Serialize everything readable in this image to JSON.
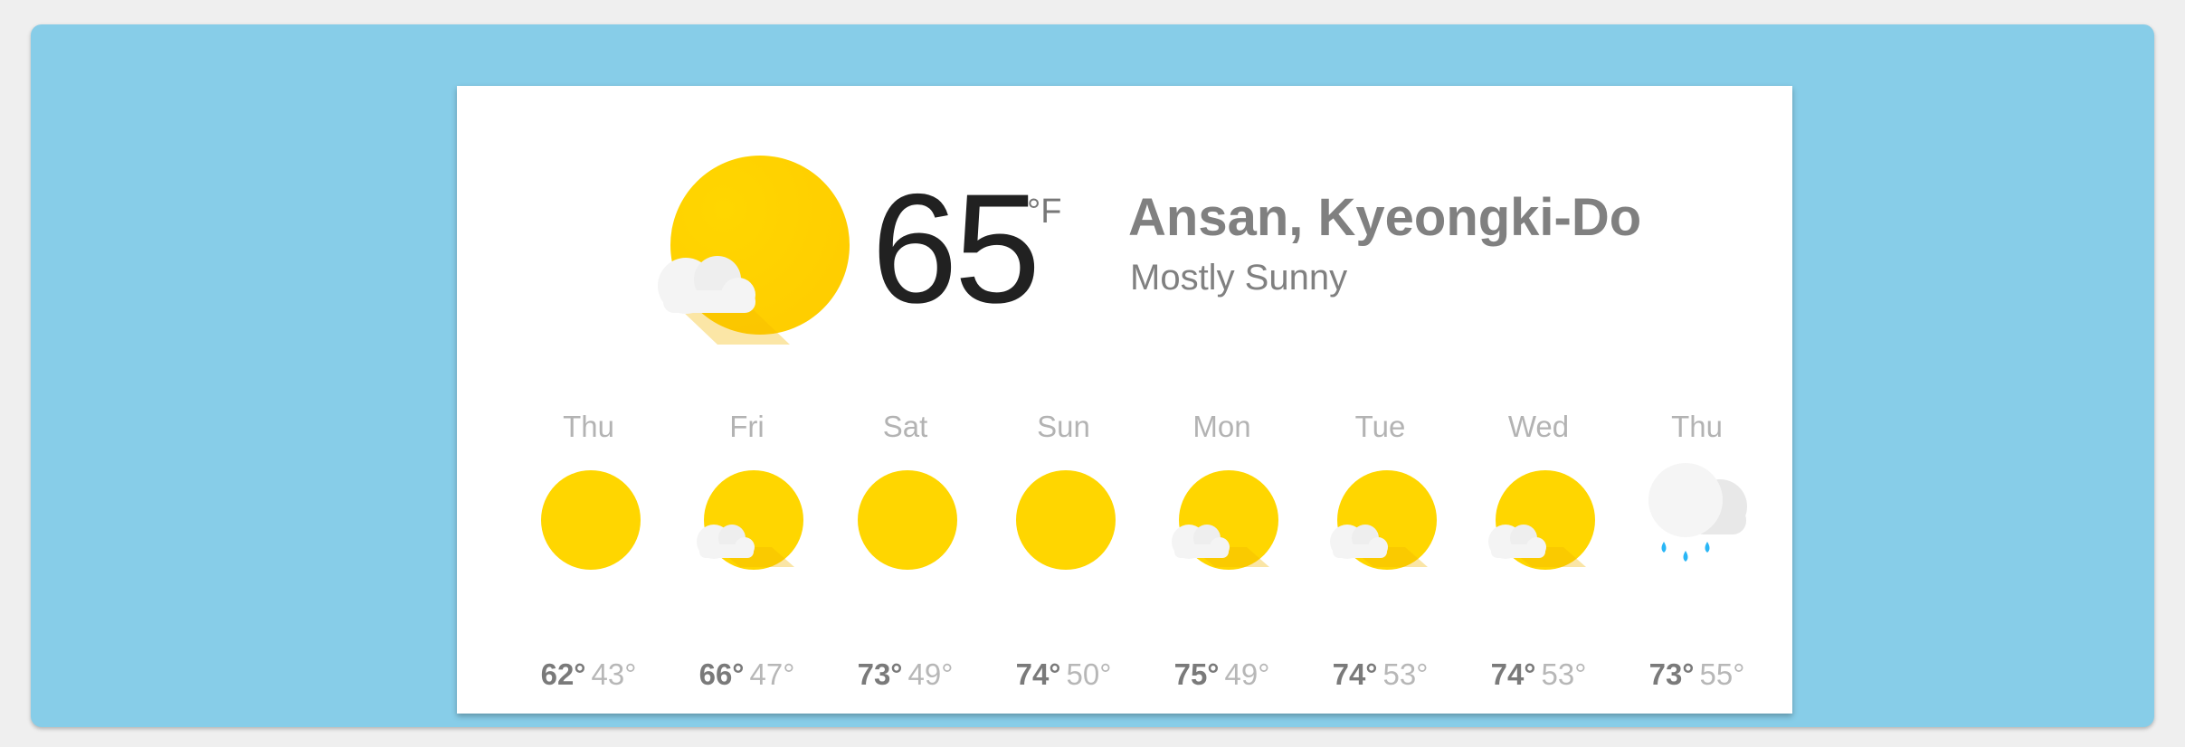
{
  "current": {
    "temperature": "65",
    "unit": "°F",
    "location": "Ansan, Kyeongki-Do",
    "condition": "Mostly Sunny",
    "icon": "mostly-sunny-icon"
  },
  "colors": {
    "background": "#87cde8",
    "sun": "#ffd600",
    "cloud": "#f2f2f2",
    "rain": "#29b6f6"
  },
  "forecast": [
    {
      "day": "Thu",
      "high": "62°",
      "low": "43°",
      "icon": "sunny-icon"
    },
    {
      "day": "Fri",
      "high": "66°",
      "low": "47°",
      "icon": "mostly-sunny-icon"
    },
    {
      "day": "Sat",
      "high": "73°",
      "low": "49°",
      "icon": "sunny-icon"
    },
    {
      "day": "Sun",
      "high": "74°",
      "low": "50°",
      "icon": "sunny-icon"
    },
    {
      "day": "Mon",
      "high": "75°",
      "low": "49°",
      "icon": "mostly-sunny-icon"
    },
    {
      "day": "Tue",
      "high": "74°",
      "low": "53°",
      "icon": "mostly-sunny-icon"
    },
    {
      "day": "Wed",
      "high": "74°",
      "low": "53°",
      "icon": "mostly-sunny-icon"
    },
    {
      "day": "Thu",
      "high": "73°",
      "low": "55°",
      "icon": "rain-icon"
    }
  ]
}
